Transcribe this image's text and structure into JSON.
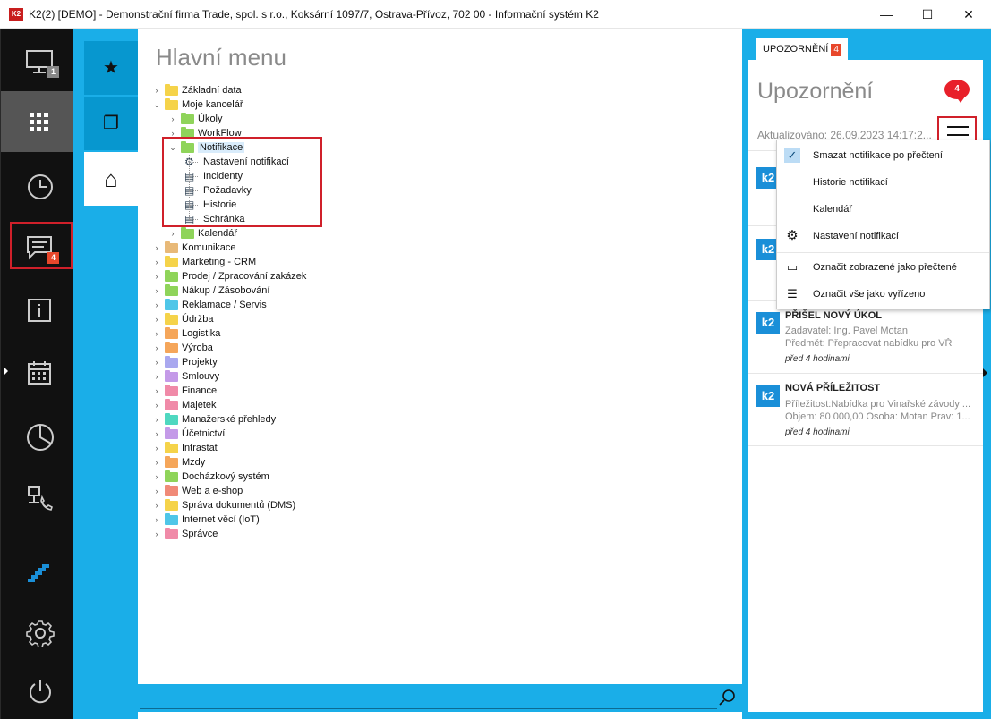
{
  "window": {
    "icon_text": "K2",
    "title": "K2(2) [DEMO] - Demonstrační firma Trade, spol. s r.o., Koksární 1097/7, Ostrava-Přívoz, 702 00 - Informační systém K2",
    "minimize": "—",
    "maximize": "☐",
    "close": "✕"
  },
  "rail": {
    "items": [
      {
        "name": "desktop",
        "badge": "1"
      },
      {
        "name": "apps-grid",
        "badge": ""
      },
      {
        "name": "history",
        "badge": ""
      },
      {
        "name": "messages",
        "badge": "4"
      },
      {
        "name": "info",
        "badge": ""
      },
      {
        "name": "calendar",
        "badge": ""
      },
      {
        "name": "reports",
        "badge": ""
      },
      {
        "name": "network-phone",
        "badge": ""
      },
      {
        "name": "k2-logo",
        "badge": ""
      },
      {
        "name": "settings",
        "badge": ""
      },
      {
        "name": "power",
        "badge": ""
      }
    ]
  },
  "strip": {
    "favorites_icon": "★",
    "windows_icon": "❐",
    "home_icon": "⌂"
  },
  "main": {
    "title": "Hlavní menu",
    "tree": [
      {
        "label": "Základní data",
        "chev": "›",
        "color": "#f5d34a"
      },
      {
        "label": "Moje kancelář",
        "chev": "⌄",
        "color": "#f5d34a"
      },
      {
        "label": "Úkoly",
        "chev": "›",
        "color": "#8fd45a"
      },
      {
        "label": "WorkFlow",
        "chev": "›",
        "color": "#8fd45a"
      },
      {
        "label": "Notifikace",
        "chev": "⌄",
        "color": "#8fd45a"
      },
      {
        "label": "Nastavení notifikací",
        "chev": "",
        "color": ""
      },
      {
        "label": "Incidenty",
        "chev": "",
        "color": ""
      },
      {
        "label": "Požadavky",
        "chev": "",
        "color": ""
      },
      {
        "label": "Historie",
        "chev": "",
        "color": ""
      },
      {
        "label": "Schránka",
        "chev": "",
        "color": ""
      },
      {
        "label": "Kalendář",
        "chev": "›",
        "color": "#8fd45a"
      },
      {
        "label": "Komunikace",
        "chev": "›",
        "color": "#e8b978"
      },
      {
        "label": "Marketing - CRM",
        "chev": "›",
        "color": "#f5d34a"
      },
      {
        "label": "Prodej / Zpracování zakázek",
        "chev": "›",
        "color": "#8fd45a"
      },
      {
        "label": "Nákup / Zásobování",
        "chev": "›",
        "color": "#8fd45a"
      },
      {
        "label": "Reklamace / Servis",
        "chev": "›",
        "color": "#4fc6e8"
      },
      {
        "label": "Údržba",
        "chev": "›",
        "color": "#f5d34a"
      },
      {
        "label": "Logistika",
        "chev": "›",
        "color": "#f5a65a"
      },
      {
        "label": "Výroba",
        "chev": "›",
        "color": "#f5a65a"
      },
      {
        "label": "Projekty",
        "chev": "›",
        "color": "#a9a8ef"
      },
      {
        "label": "Smlouvy",
        "chev": "›",
        "color": "#c49ae8"
      },
      {
        "label": "Finance",
        "chev": "›",
        "color": "#f08aa8"
      },
      {
        "label": "Majetek",
        "chev": "›",
        "color": "#f08aa8"
      },
      {
        "label": "Manažerské přehledy",
        "chev": "›",
        "color": "#4fd8c0"
      },
      {
        "label": "Účetnictví",
        "chev": "›",
        "color": "#c49ae8"
      },
      {
        "label": "Intrastat",
        "chev": "›",
        "color": "#f5d34a"
      },
      {
        "label": "Mzdy",
        "chev": "›",
        "color": "#f5a65a"
      },
      {
        "label": "Docházkový systém",
        "chev": "›",
        "color": "#8fd45a"
      },
      {
        "label": "Web a e-shop",
        "chev": "›",
        "color": "#f08a78"
      },
      {
        "label": "Správa dokumentů (DMS)",
        "chev": "›",
        "color": "#f5d34a"
      },
      {
        "label": "Internet věcí (IoT)",
        "chev": "›",
        "color": "#4fc6e8"
      },
      {
        "label": "Správce",
        "chev": "›",
        "color": "#f08aa8"
      }
    ]
  },
  "notifications": {
    "tab_label": "UPOZORNĚNÍ",
    "tab_count": "4",
    "title": "Upozornění",
    "bubble_count": "4",
    "updated": "Aktualizováno: 26.09.2023 14:17:2...",
    "cards": [
      {
        "logo": "k2",
        "title": "",
        "line1": "",
        "line2": "",
        "time": ""
      },
      {
        "logo": "k2",
        "title": "",
        "line1": "",
        "line2": "",
        "time": ""
      },
      {
        "logo": "k2",
        "title": "PŘIŠEL NOVÝ ÚKOL",
        "line1": "Zadavatel: Ing. Pavel Motan",
        "line2": "Předmět: Přepracovat nabídku pro VŘ",
        "time": "před 4 hodinami"
      },
      {
        "logo": "k2",
        "title": "NOVÁ PŘÍLEŽITOST",
        "line1": "Příležitost:Nabídka pro Vinařské závody ...",
        "line2": "Objem: 80 000,00 Osoba: Motan Prav: 1...",
        "time": "před 4 hodinami"
      }
    ]
  },
  "menu": {
    "items": [
      {
        "icon": "✓",
        "label": "Smazat notifikace po přečtení"
      },
      {
        "icon": "",
        "label": "Historie notifikací"
      },
      {
        "icon": "",
        "label": "Kalendář"
      },
      {
        "icon": "⚙",
        "label": "Nastavení notifikací"
      },
      {
        "icon": "▭",
        "label": "Označit zobrazené jako přečtené"
      },
      {
        "icon": "☰",
        "label": "Označit vše jako vyřízeno"
      }
    ]
  }
}
